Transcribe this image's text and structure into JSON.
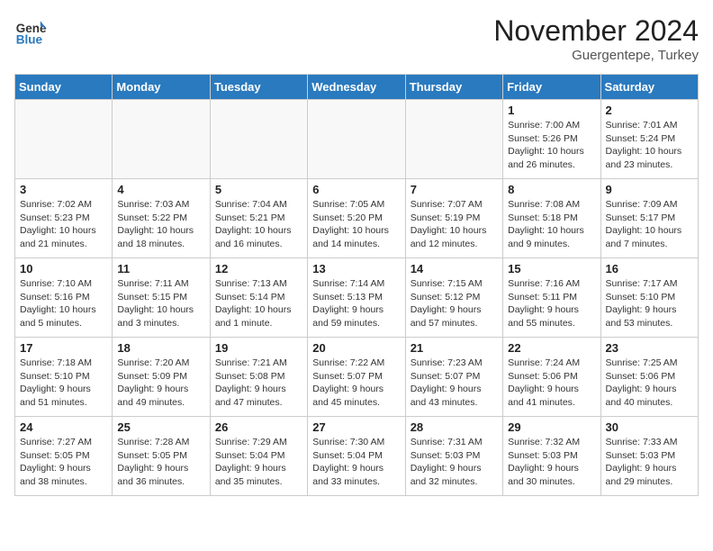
{
  "header": {
    "logo_line1": "General",
    "logo_line2": "Blue",
    "month": "November 2024",
    "location": "Guergentepe, Turkey"
  },
  "days_of_week": [
    "Sunday",
    "Monday",
    "Tuesday",
    "Wednesday",
    "Thursday",
    "Friday",
    "Saturday"
  ],
  "weeks": [
    [
      {
        "day": "",
        "info": ""
      },
      {
        "day": "",
        "info": ""
      },
      {
        "day": "",
        "info": ""
      },
      {
        "day": "",
        "info": ""
      },
      {
        "day": "",
        "info": ""
      },
      {
        "day": "1",
        "info": "Sunrise: 7:00 AM\nSunset: 5:26 PM\nDaylight: 10 hours and 26 minutes."
      },
      {
        "day": "2",
        "info": "Sunrise: 7:01 AM\nSunset: 5:24 PM\nDaylight: 10 hours and 23 minutes."
      }
    ],
    [
      {
        "day": "3",
        "info": "Sunrise: 7:02 AM\nSunset: 5:23 PM\nDaylight: 10 hours and 21 minutes."
      },
      {
        "day": "4",
        "info": "Sunrise: 7:03 AM\nSunset: 5:22 PM\nDaylight: 10 hours and 18 minutes."
      },
      {
        "day": "5",
        "info": "Sunrise: 7:04 AM\nSunset: 5:21 PM\nDaylight: 10 hours and 16 minutes."
      },
      {
        "day": "6",
        "info": "Sunrise: 7:05 AM\nSunset: 5:20 PM\nDaylight: 10 hours and 14 minutes."
      },
      {
        "day": "7",
        "info": "Sunrise: 7:07 AM\nSunset: 5:19 PM\nDaylight: 10 hours and 12 minutes."
      },
      {
        "day": "8",
        "info": "Sunrise: 7:08 AM\nSunset: 5:18 PM\nDaylight: 10 hours and 9 minutes."
      },
      {
        "day": "9",
        "info": "Sunrise: 7:09 AM\nSunset: 5:17 PM\nDaylight: 10 hours and 7 minutes."
      }
    ],
    [
      {
        "day": "10",
        "info": "Sunrise: 7:10 AM\nSunset: 5:16 PM\nDaylight: 10 hours and 5 minutes."
      },
      {
        "day": "11",
        "info": "Sunrise: 7:11 AM\nSunset: 5:15 PM\nDaylight: 10 hours and 3 minutes."
      },
      {
        "day": "12",
        "info": "Sunrise: 7:13 AM\nSunset: 5:14 PM\nDaylight: 10 hours and 1 minute."
      },
      {
        "day": "13",
        "info": "Sunrise: 7:14 AM\nSunset: 5:13 PM\nDaylight: 9 hours and 59 minutes."
      },
      {
        "day": "14",
        "info": "Sunrise: 7:15 AM\nSunset: 5:12 PM\nDaylight: 9 hours and 57 minutes."
      },
      {
        "day": "15",
        "info": "Sunrise: 7:16 AM\nSunset: 5:11 PM\nDaylight: 9 hours and 55 minutes."
      },
      {
        "day": "16",
        "info": "Sunrise: 7:17 AM\nSunset: 5:10 PM\nDaylight: 9 hours and 53 minutes."
      }
    ],
    [
      {
        "day": "17",
        "info": "Sunrise: 7:18 AM\nSunset: 5:10 PM\nDaylight: 9 hours and 51 minutes."
      },
      {
        "day": "18",
        "info": "Sunrise: 7:20 AM\nSunset: 5:09 PM\nDaylight: 9 hours and 49 minutes."
      },
      {
        "day": "19",
        "info": "Sunrise: 7:21 AM\nSunset: 5:08 PM\nDaylight: 9 hours and 47 minutes."
      },
      {
        "day": "20",
        "info": "Sunrise: 7:22 AM\nSunset: 5:07 PM\nDaylight: 9 hours and 45 minutes."
      },
      {
        "day": "21",
        "info": "Sunrise: 7:23 AM\nSunset: 5:07 PM\nDaylight: 9 hours and 43 minutes."
      },
      {
        "day": "22",
        "info": "Sunrise: 7:24 AM\nSunset: 5:06 PM\nDaylight: 9 hours and 41 minutes."
      },
      {
        "day": "23",
        "info": "Sunrise: 7:25 AM\nSunset: 5:06 PM\nDaylight: 9 hours and 40 minutes."
      }
    ],
    [
      {
        "day": "24",
        "info": "Sunrise: 7:27 AM\nSunset: 5:05 PM\nDaylight: 9 hours and 38 minutes."
      },
      {
        "day": "25",
        "info": "Sunrise: 7:28 AM\nSunset: 5:05 PM\nDaylight: 9 hours and 36 minutes."
      },
      {
        "day": "26",
        "info": "Sunrise: 7:29 AM\nSunset: 5:04 PM\nDaylight: 9 hours and 35 minutes."
      },
      {
        "day": "27",
        "info": "Sunrise: 7:30 AM\nSunset: 5:04 PM\nDaylight: 9 hours and 33 minutes."
      },
      {
        "day": "28",
        "info": "Sunrise: 7:31 AM\nSunset: 5:03 PM\nDaylight: 9 hours and 32 minutes."
      },
      {
        "day": "29",
        "info": "Sunrise: 7:32 AM\nSunset: 5:03 PM\nDaylight: 9 hours and 30 minutes."
      },
      {
        "day": "30",
        "info": "Sunrise: 7:33 AM\nSunset: 5:03 PM\nDaylight: 9 hours and 29 minutes."
      }
    ]
  ]
}
